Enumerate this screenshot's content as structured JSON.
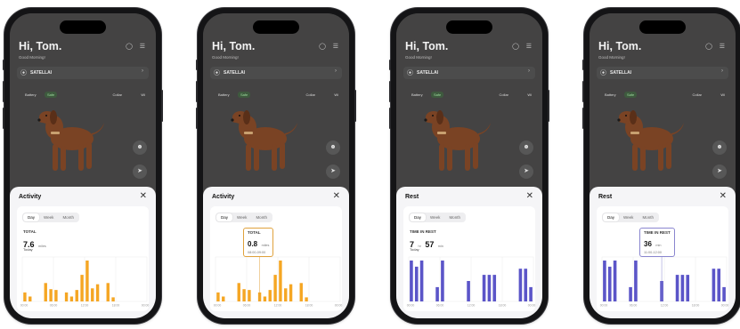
{
  "common": {
    "greeting": "Hi, Tom.",
    "subtitle": "Good Morning!",
    "device_name": "SATELLAI",
    "battery_label": "Battery",
    "battery_status": "Safe",
    "collar_label": "Collar",
    "wifi_label": "Wi",
    "tabs": [
      "Day",
      "Week",
      "Month"
    ],
    "x_ticks": [
      "00:00",
      "06:00",
      "12:00",
      "18:00",
      "00:00"
    ]
  },
  "colors": {
    "activity_bar": "#F5A623",
    "rest_bar": "#5B55C8",
    "tooltip_activity_border": "#E0A23D",
    "tooltip_rest_border": "#8A86CF"
  },
  "phones": [
    {
      "sheet_title": "Activity",
      "active_tab": "Day",
      "metric_label": "TOTAL",
      "metric_value": "7.6",
      "metric_unit": "miles",
      "metric_sub": "Today",
      "chart_data": {
        "type": "bar",
        "x_range": [
          0,
          24
        ],
        "hours": [
          0,
          1,
          4,
          5,
          6,
          8,
          9,
          10,
          11,
          12,
          13,
          14,
          16,
          17
        ],
        "values": [
          0.22,
          0.12,
          0.45,
          0.3,
          0.28,
          0.22,
          0.12,
          0.28,
          0.65,
          1.0,
          0.32,
          0.42,
          0.45,
          0.1
        ]
      }
    },
    {
      "sheet_title": "Activity",
      "active_tab": "Day",
      "tooltip_label": "TOTAL",
      "tooltip_value": "0.8",
      "tooltip_unit": "miles",
      "tooltip_range": "08:00-09:00",
      "tooltip_hour": 8,
      "chart_data": {
        "type": "bar",
        "x_range": [
          0,
          24
        ],
        "hours": [
          0,
          1,
          4,
          5,
          6,
          8,
          9,
          10,
          11,
          12,
          13,
          14,
          16,
          17
        ],
        "values": [
          0.22,
          0.12,
          0.45,
          0.3,
          0.28,
          0.22,
          0.12,
          0.28,
          0.65,
          1.0,
          0.32,
          0.42,
          0.45,
          0.1
        ]
      }
    },
    {
      "sheet_title": "Rest",
      "active_tab": "Day",
      "metric_label": "TIME IN REST",
      "metric_hours": "7",
      "metric_h_unit": "hr",
      "metric_mins": "57",
      "metric_m_unit": "min",
      "metric_sub": "Today",
      "chart_data": {
        "type": "bar",
        "x_range": [
          0,
          24
        ],
        "hours": [
          0,
          1,
          2,
          5,
          6,
          11,
          14,
          15,
          16,
          21,
          22,
          23
        ],
        "values": [
          1.0,
          0.85,
          1.0,
          0.35,
          1.0,
          0.5,
          0.65,
          0.65,
          0.65,
          0.8,
          0.8,
          0.35
        ]
      }
    },
    {
      "sheet_title": "Rest",
      "active_tab": "Day",
      "tooltip_label": "TIME IN REST",
      "tooltip_value": "36",
      "tooltip_unit": "min",
      "tooltip_range": "11:00-12:00",
      "tooltip_hour": 11,
      "chart_data": {
        "type": "bar",
        "x_range": [
          0,
          24
        ],
        "hours": [
          0,
          1,
          2,
          5,
          6,
          11,
          14,
          15,
          16,
          21,
          22,
          23
        ],
        "values": [
          1.0,
          0.85,
          1.0,
          0.35,
          1.0,
          0.5,
          0.65,
          0.65,
          0.65,
          0.8,
          0.8,
          0.35
        ]
      }
    }
  ]
}
